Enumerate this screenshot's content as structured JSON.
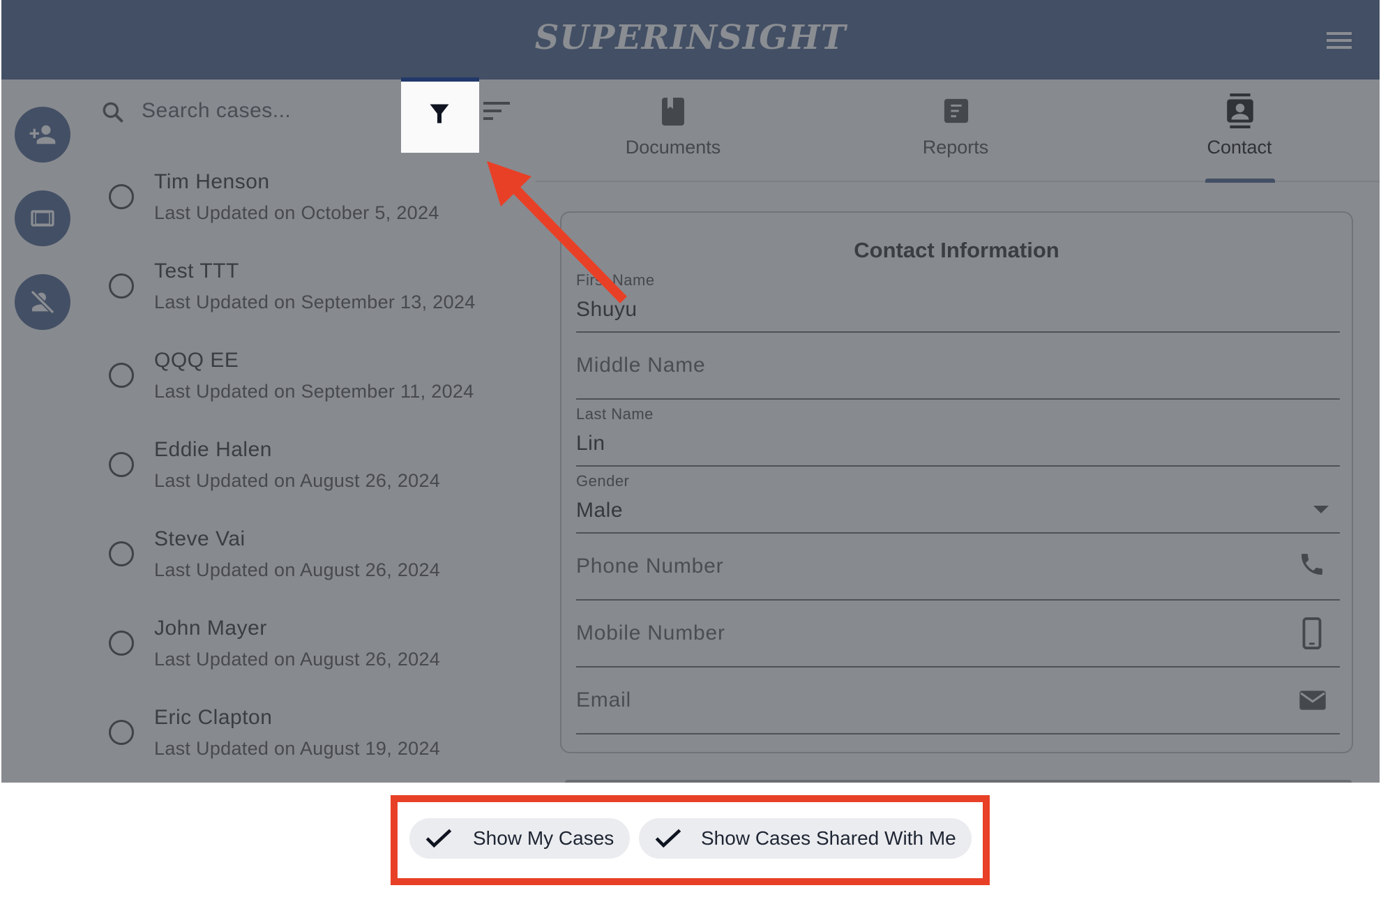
{
  "header": {
    "brand": "SUPERINSIGHT",
    "menu_icon": "hamburger-menu-icon"
  },
  "sidebar": {
    "buttons": [
      {
        "icon": "add-person-icon"
      },
      {
        "icon": "panel-icon"
      },
      {
        "icon": "person-off-icon"
      }
    ]
  },
  "search": {
    "placeholder": "Search cases...",
    "filter_icon": "filter-icon",
    "sort_icon": "sort-icon"
  },
  "cases": [
    {
      "name": "Tim Henson",
      "date": "Last Updated on October 5, 2024"
    },
    {
      "name": "Test TTT",
      "date": "Last Updated on September 13, 2024"
    },
    {
      "name": "QQQ EE",
      "date": "Last Updated on September 11, 2024"
    },
    {
      "name": "Eddie Halen",
      "date": "Last Updated on August 26, 2024"
    },
    {
      "name": "Steve Vai",
      "date": "Last Updated on August 26, 2024"
    },
    {
      "name": "John Mayer",
      "date": "Last Updated on August 26, 2024"
    },
    {
      "name": "Eric Clapton",
      "date": "Last Updated on August 19, 2024"
    }
  ],
  "tabs": [
    {
      "label": "Documents"
    },
    {
      "label": "Reports"
    },
    {
      "label": "Contact",
      "active": true
    }
  ],
  "contact": {
    "title": "Contact Information",
    "first_name": {
      "label": "First Name",
      "value": "Shuyu"
    },
    "middle_name": {
      "placeholder": "Middle Name"
    },
    "last_name": {
      "label": "Last Name",
      "value": "Lin"
    },
    "gender": {
      "label": "Gender",
      "value": "Male"
    },
    "phone": {
      "placeholder": "Phone Number"
    },
    "mobile": {
      "placeholder": "Mobile Number"
    },
    "email": {
      "placeholder": "Email"
    }
  },
  "filters": [
    {
      "label": "Show My Cases",
      "checked": true
    },
    {
      "label": "Show Cases Shared With Me",
      "checked": true
    }
  ],
  "colors": {
    "header": "#434f64",
    "overlay": "#878a8f",
    "annotation": "#e84027"
  }
}
